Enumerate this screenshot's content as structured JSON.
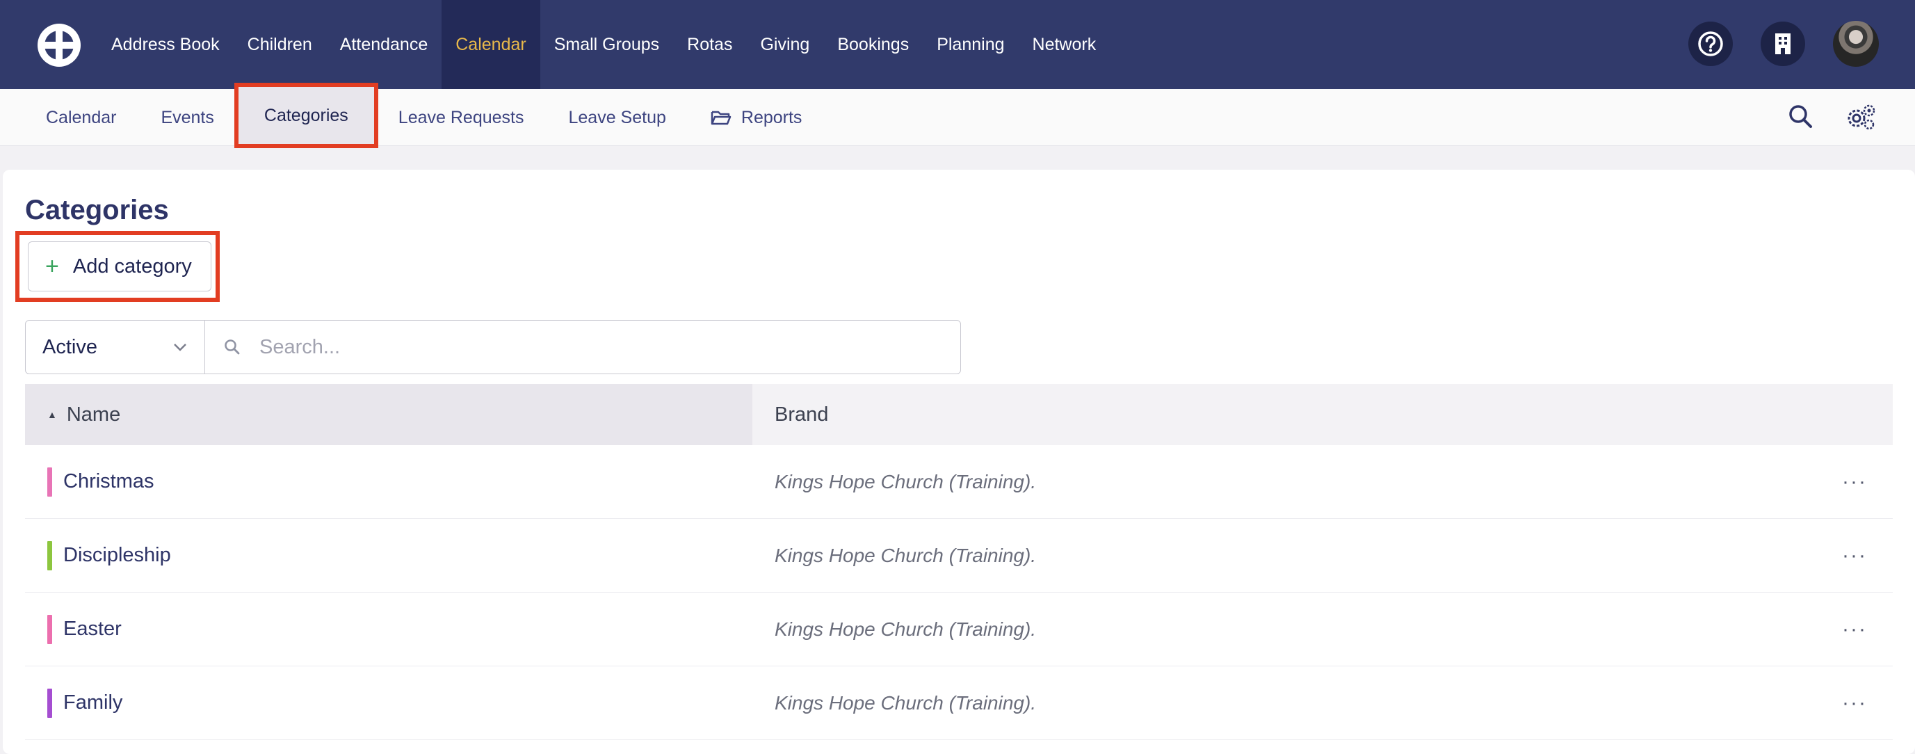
{
  "topnav": {
    "items": [
      {
        "label": "Address Book"
      },
      {
        "label": "Children"
      },
      {
        "label": "Attendance"
      },
      {
        "label": "Calendar"
      },
      {
        "label": "Small Groups"
      },
      {
        "label": "Rotas"
      },
      {
        "label": "Giving"
      },
      {
        "label": "Bookings"
      },
      {
        "label": "Planning"
      },
      {
        "label": "Network"
      }
    ],
    "active_index": 3
  },
  "subnav": {
    "items": [
      {
        "label": "Calendar"
      },
      {
        "label": "Events"
      },
      {
        "label": "Categories"
      },
      {
        "label": "Leave Requests"
      },
      {
        "label": "Leave Setup"
      },
      {
        "label": "Reports"
      }
    ],
    "active_index": 2
  },
  "page": {
    "title": "Categories",
    "add_button": "Add category",
    "status_select": "Active",
    "search_placeholder": "Search..."
  },
  "table": {
    "columns": {
      "name": "Name",
      "brand": "Brand"
    },
    "rows": [
      {
        "name": "Christmas",
        "brand": "Kings Hope Church (Training).",
        "color": "#e874b6"
      },
      {
        "name": "Discipleship",
        "brand": "Kings Hope Church (Training).",
        "color": "#8dc63f"
      },
      {
        "name": "Easter",
        "brand": "Kings Hope Church (Training).",
        "color": "#ec6fae"
      },
      {
        "name": "Family",
        "brand": "Kings Hope Church (Training).",
        "color": "#a54ed1"
      }
    ]
  },
  "colors": {
    "topbar": "#313a6b",
    "active_topnav": "#e8b84a",
    "highlight": "#e23d22"
  }
}
